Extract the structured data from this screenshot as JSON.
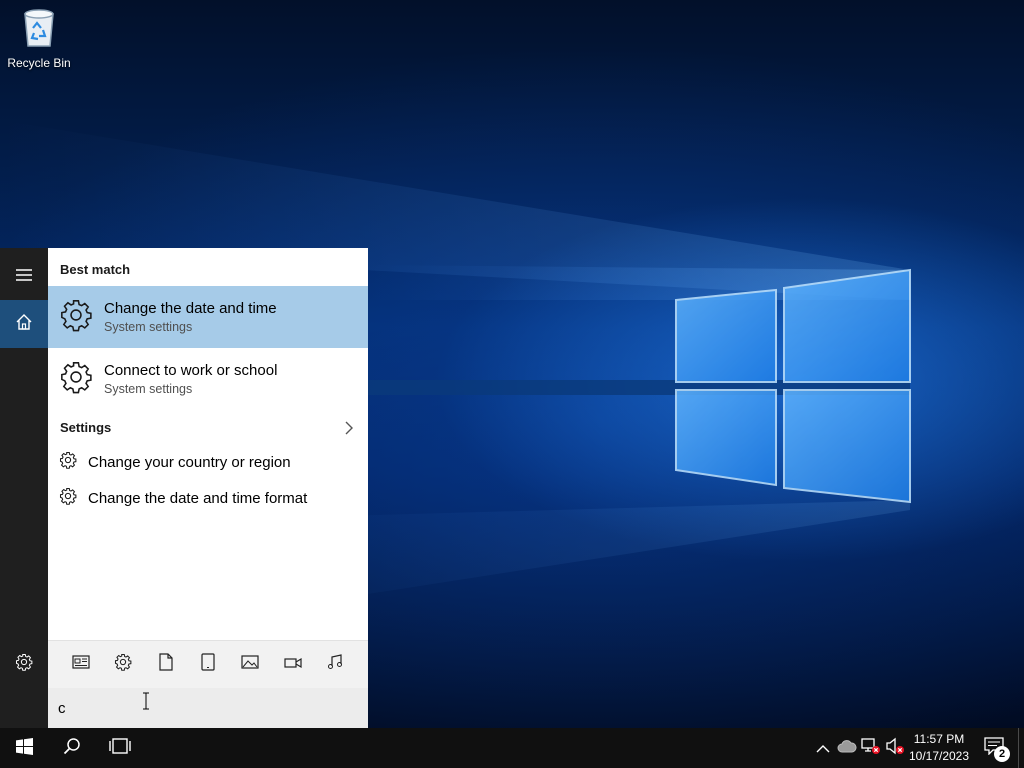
{
  "desktop": {
    "recycle_bin_label": "Recycle Bin"
  },
  "search": {
    "best_match_heading": "Best match",
    "best_matches": [
      {
        "title": "Change the date and time",
        "subtitle": "System settings",
        "selected": true
      },
      {
        "title": "Connect to work or school",
        "subtitle": "System settings",
        "selected": false
      }
    ],
    "settings_heading": "Settings",
    "settings_items": [
      {
        "label": "Change your country or region"
      },
      {
        "label": "Change the date and time format"
      }
    ],
    "query_value": "c",
    "filters": [
      "news-icon",
      "gear-icon",
      "document-icon",
      "tablet-icon",
      "photo-icon",
      "video-icon",
      "music-icon"
    ]
  },
  "taskbar": {
    "time": "11:57 PM",
    "date": "10/17/2023",
    "notification_count": "2"
  },
  "colors": {
    "selected_bg": "#a6cbe8",
    "home_accent": "#1e4f7c",
    "rail_bg": "#1f1f1f",
    "taskbar_bg": "#101010"
  }
}
